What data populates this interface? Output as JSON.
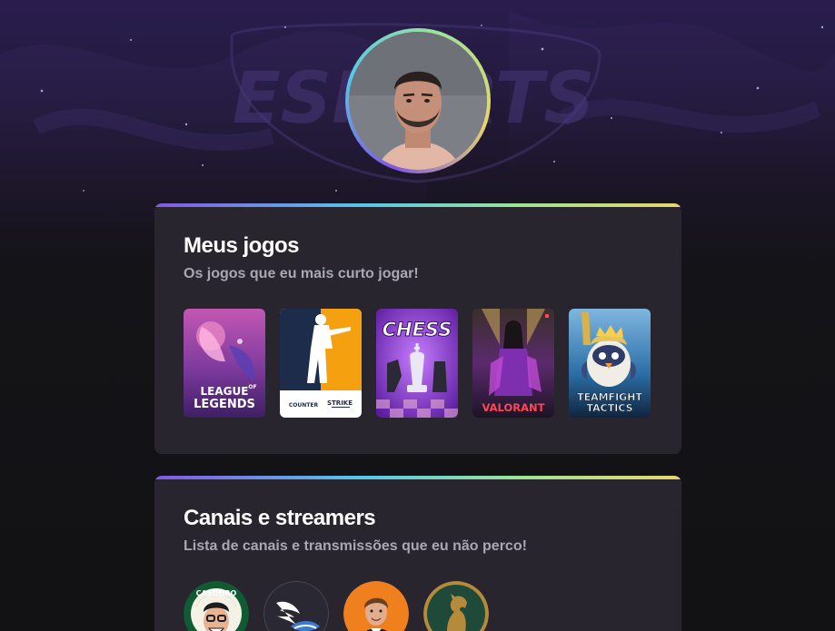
{
  "profile": {
    "avatar_alt": "Foto de perfil"
  },
  "games_section": {
    "title": "Meus jogos",
    "subtitle": "Os jogos que eu mais curto jogar!",
    "games": [
      {
        "name": "League of Legends",
        "label_top": "LEAGUE",
        "label_of": "OF",
        "label_bottom": "LEGENDS",
        "color": "#b04aa8"
      },
      {
        "name": "Counter Strike",
        "label_left": "COUNTER",
        "label_right": "STRIKE",
        "color": "#f5a00f"
      },
      {
        "name": "Chess",
        "label": "CHESS",
        "color": "#7a2fc7"
      },
      {
        "name": "Valorant",
        "label": "VALORANT",
        "color": "#ff4655"
      },
      {
        "name": "Teamfight Tactics",
        "label_top": "TEAMFIGHT",
        "label_bottom": "TACTICS",
        "color": "#2d8fd9"
      }
    ]
  },
  "channels_section": {
    "title": "Canais e streamers",
    "subtitle": "Lista de canais e transmissões que eu não perco!",
    "channels": [
      {
        "name": "Casimiro",
        "label": "CASIMIRO"
      },
      {
        "name": "Canal com logo de asa",
        "label": ""
      },
      {
        "name": "Streamer",
        "label": ""
      },
      {
        "name": "Canal com logo de cavalo",
        "label": ""
      }
    ]
  },
  "background": {
    "watermark_text": "ESPORTS"
  },
  "colors": {
    "card_bg": "#29252f",
    "title": "#ffffff",
    "subtitle": "#a8a8b3",
    "gradient": [
      "#8257e5",
      "#56c8e8",
      "#9ee493",
      "#e9d66b"
    ]
  }
}
